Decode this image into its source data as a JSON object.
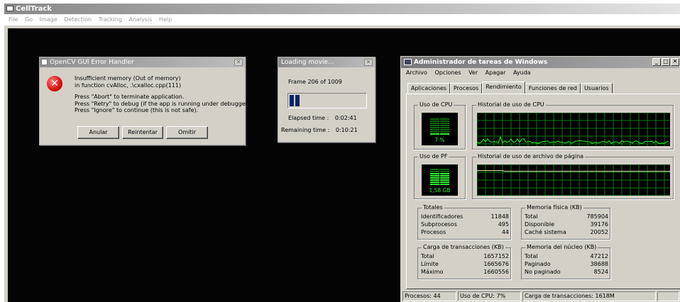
{
  "app": {
    "title": "CellTrack",
    "menu": [
      "File",
      "Go",
      "Image",
      "Detection",
      "Tracking",
      "Analysis",
      "Help"
    ]
  },
  "error_dialog": {
    "title": "OpenCV GUI Error Handler",
    "lines": [
      "Insufficient memory (Out of memory)",
      "in function cvAlloc, .\\cxalloc.cpp(111)",
      "Press \"Abort\" to terminate application.",
      "Press \"Retry\" to debug (if the app is running under debugger).",
      "Press \"Ignore\" to continue (this is not safe)."
    ],
    "buttons": {
      "abort": "Anular",
      "retry": "Reintentar",
      "ignore": "Omitir"
    }
  },
  "loading_dialog": {
    "title": "Loading movie...",
    "frame_text": "Frame 206 of 1009",
    "progress": 0.2,
    "elapsed_label": "Elapsed time :",
    "elapsed_value": "0:02:41",
    "remaining_label": "Remaining time :",
    "remaining_value": "0:10:21"
  },
  "task_manager": {
    "title": "Administrador de tareas de Windows",
    "menu": [
      "Archivo",
      "Opciones",
      "Ver",
      "Apagar",
      "Ayuda"
    ],
    "tabs": [
      "Aplicaciones",
      "Procesos",
      "Rendimiento",
      "Funciones de red",
      "Usuarios"
    ],
    "active_tab": "Rendimiento",
    "cpu_usage": {
      "label": "Uso de CPU",
      "value": "7 %",
      "level": 0.07
    },
    "cpu_history": {
      "label": "Historial de uso de CPU"
    },
    "pf_usage": {
      "label": "Uso de PF",
      "value": "1,58 GB",
      "level": 0.7
    },
    "pf_history": {
      "label": "Historial de uso de archivo de página"
    },
    "totals": {
      "label": "Totales",
      "rows": [
        {
          "name": "Identificadores",
          "value": "11848"
        },
        {
          "name": "Subprocesos",
          "value": "495"
        },
        {
          "name": "Procesos",
          "value": "44"
        }
      ]
    },
    "physical_memory": {
      "label": "Memoria física (KB)",
      "rows": [
        {
          "name": "Total",
          "value": "785904"
        },
        {
          "name": "Disponible",
          "value": "39176"
        },
        {
          "name": "Caché sistema",
          "value": "20052"
        }
      ]
    },
    "commit_charge": {
      "label": "Carga de transacciones (KB)",
      "rows": [
        {
          "name": "Total",
          "value": "1657152"
        },
        {
          "name": "Límite",
          "value": "1665676"
        },
        {
          "name": "Máximo",
          "value": "1660556"
        }
      ]
    },
    "kernel_memory": {
      "label": "Memoria del núcleo (KB)",
      "rows": [
        {
          "name": "Total",
          "value": "47212"
        },
        {
          "name": "Paginado",
          "value": "38688"
        },
        {
          "name": "No paginado",
          "value": "8524"
        }
      ]
    },
    "status": {
      "processes": "Procesos: 44",
      "cpu": "Uso de CPU: 7%",
      "commit": "Carga de transacciones: 1618M"
    }
  }
}
